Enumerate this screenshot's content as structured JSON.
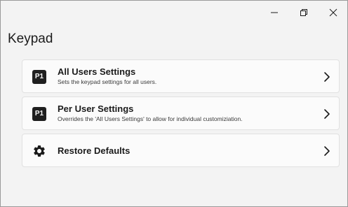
{
  "window": {
    "controls": {
      "minimize": "minimize-icon",
      "maximize": "restore-icon",
      "close": "close-icon"
    }
  },
  "page": {
    "title": "Keypad"
  },
  "cards": [
    {
      "icon_text": "P1",
      "icon": "p1-badge-icon",
      "title": "All Users Settings",
      "description": "Sets the keypad settings for all users."
    },
    {
      "icon_text": "P1",
      "icon": "p1-badge-icon",
      "title": "Per User Settings",
      "description": "Overrides the 'All Users Settings' to allow for individual customiziation."
    },
    {
      "icon": "gear-icon",
      "title": "Restore Defaults"
    }
  ],
  "colors": {
    "window_bg": "#f3f3f3",
    "card_bg": "#fbfbfb",
    "card_border": "#e1e1e1",
    "badge_bg": "#1f1f1f"
  }
}
